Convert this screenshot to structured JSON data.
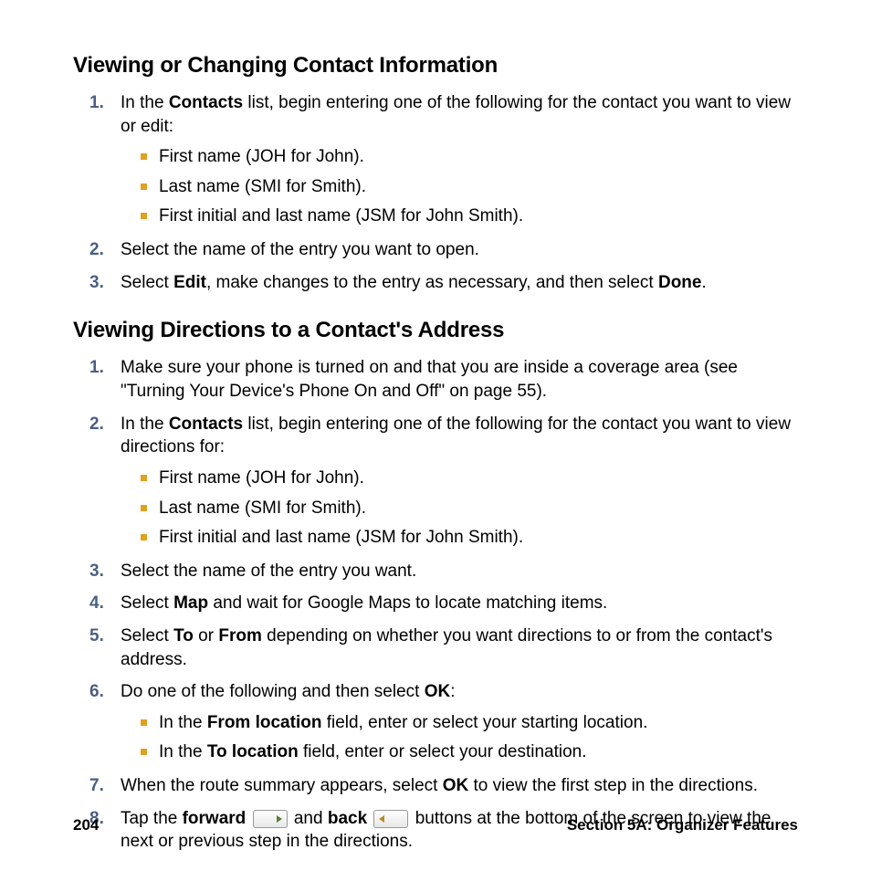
{
  "section1": {
    "heading": "Viewing or Changing Contact Information",
    "steps": [
      {
        "num": "1.",
        "pre": "In the ",
        "bold1": "Contacts",
        "post": " list, begin entering one of the following for the contact you want to view or edit:",
        "bullets": [
          "First name (JOH for John).",
          "Last name (SMI for Smith).",
          "First initial and last name (JSM for John Smith)."
        ]
      },
      {
        "num": "2.",
        "text": "Select the name of the entry you want to open."
      },
      {
        "num": "3.",
        "pre": "Select ",
        "bold1": "Edit",
        "mid": ", make changes to the entry as necessary, and then select ",
        "bold2": "Done",
        "post": "."
      }
    ]
  },
  "section2": {
    "heading": "Viewing Directions to a Contact's Address",
    "steps": [
      {
        "num": "1.",
        "text": "Make sure your phone is turned on and that you are inside a coverage area (see \"Turning Your Device's Phone On and Off\" on page 55)."
      },
      {
        "num": "2.",
        "pre": "In the ",
        "bold1": "Contacts",
        "post": " list, begin entering one of the following for the contact you want to view directions for:",
        "bullets": [
          "First name (JOH for John).",
          "Last name (SMI for Smith).",
          "First initial and last name (JSM for John Smith)."
        ]
      },
      {
        "num": "3.",
        "text": "Select the name of the entry you want."
      },
      {
        "num": "4.",
        "pre": "Select ",
        "bold1": "Map",
        "post": " and wait for Google Maps to locate matching items."
      },
      {
        "num": "5.",
        "pre": "Select ",
        "bold1": "To",
        "mid": " or ",
        "bold2": "From",
        "post": " depending on whether you want directions to or from the contact's address."
      },
      {
        "num": "6.",
        "pre": "Do one of the following and then select ",
        "bold1": "OK",
        "post": ":",
        "bullets_rich": [
          {
            "pre": "In the ",
            "bold": "From location",
            "post": " field, enter or select your starting location."
          },
          {
            "pre": "In the ",
            "bold": "To location",
            "post": " field, enter or select your destination."
          }
        ]
      },
      {
        "num": "7.",
        "pre": "When the route summary appears, select ",
        "bold1": "OK",
        "post": " to view the first step in the directions."
      },
      {
        "num": "8.",
        "pre": "Tap the ",
        "bold1": "forward",
        "icon1": "forward-button-icon",
        "mid": " and ",
        "bold2": "back",
        "icon2": "back-button-icon",
        "post": " buttons at the bottom of the screen to view the next or previous step in the directions."
      }
    ]
  },
  "footer": {
    "page": "204",
    "section": "Section 5A: Organizer Features"
  }
}
